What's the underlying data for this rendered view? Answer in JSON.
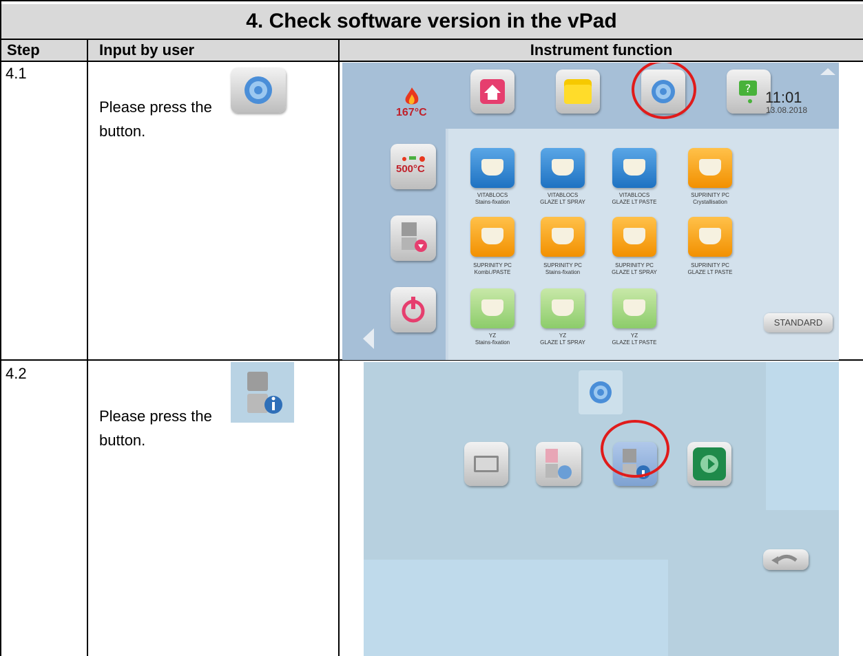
{
  "title": "4. Check software version in the vPad",
  "columns": {
    "step": "Step",
    "input": "Input by user",
    "function": "Instrument function"
  },
  "rows": [
    {
      "step": "4.1",
      "text_before": "Please press the",
      "text_after": "button."
    },
    {
      "step": "4.2",
      "text_before": "Please press the",
      "text_after": "button."
    }
  ],
  "screen1": {
    "temperature": "167°C",
    "time": "11:01",
    "date": "13.08.2018",
    "preheat_temp": "500°C",
    "standard_label": "STANDARD",
    "programs": [
      {
        "line1": "VITABLOCS",
        "line2": "Stains-fixation",
        "color": "blue"
      },
      {
        "line1": "VITABLOCS",
        "line2": "GLAZE LT SPRAY",
        "color": "blue"
      },
      {
        "line1": "VITABLOCS",
        "line2": "GLAZE LT PASTE",
        "color": "blue"
      },
      {
        "line1": "SUPRINITY PC",
        "line2": "Crystallisation",
        "color": "orange"
      },
      {
        "line1": "SUPRINITY PC",
        "line2": "Kombi./PASTE",
        "color": "orange"
      },
      {
        "line1": "SUPRINITY PC",
        "line2": "Stains-fixation",
        "color": "orange"
      },
      {
        "line1": "SUPRINITY PC",
        "line2": "GLAZE LT SPRAY",
        "color": "orange"
      },
      {
        "line1": "SUPRINITY PC",
        "line2": "GLAZE LT PASTE",
        "color": "orange"
      },
      {
        "line1": "YZ",
        "line2": "Stains-fixation",
        "color": "green"
      },
      {
        "line1": "YZ",
        "line2": "GLAZE LT SPRAY",
        "color": "green"
      },
      {
        "line1": "YZ",
        "line2": "GLAZE LT PASTE",
        "color": "green"
      }
    ]
  },
  "colors": {
    "highlight_ring": "#e01b1b",
    "header_fill": "#d9d9d9"
  }
}
